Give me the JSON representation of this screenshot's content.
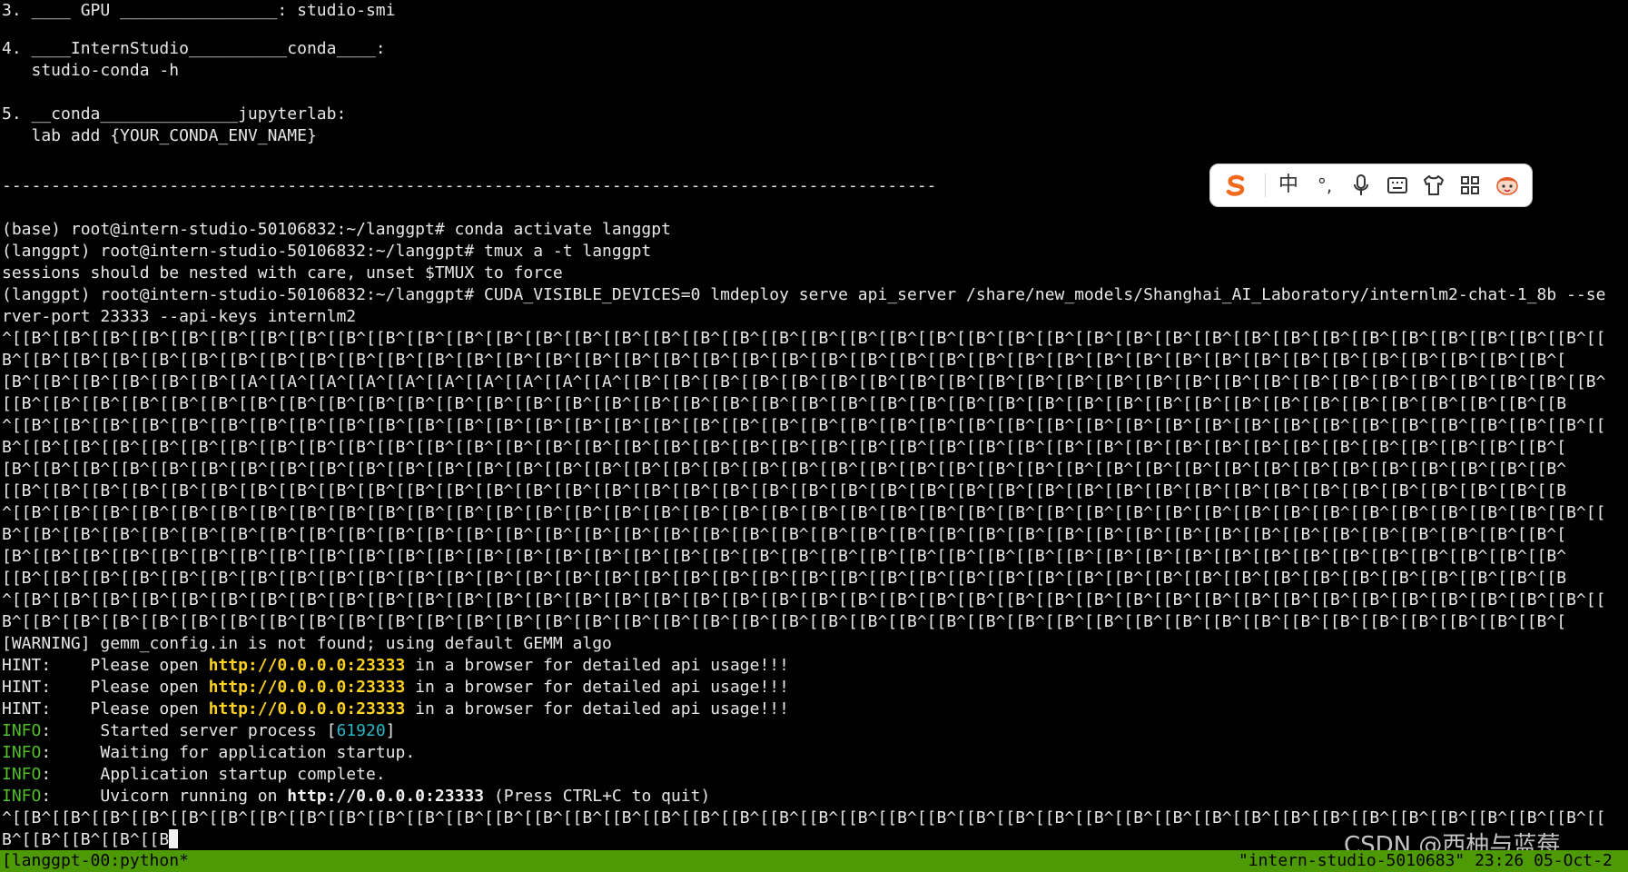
{
  "terminal": {
    "lines": {
      "l1": "3. ____ GPU ________________: studio-smi",
      "l2": "4. ____InternStudio__________conda____:",
      "l3": "   studio-conda -h",
      "l4": "5. __conda______________jupyterlab:",
      "l5": "   lab add {YOUR_CONDA_ENV_NAME}",
      "l6": "-----------------------------------------------------------------------------------------------",
      "l7": "(base) root@intern-studio-50106832:~/langgpt# conda activate langgpt",
      "l8": "(langgpt) root@intern-studio-50106832:~/langgpt# tmux a -t langgpt",
      "l9": "sessions should be nested with care, unset $TMUX to force",
      "l10": "(langgpt) root@intern-studio-50106832:~/langgpt# CUDA_VISIBLE_DEVICES=0 lmdeploy serve api_server /share/new_models/Shanghai_AI_Laboratory/internlm2-chat-1_8b --se",
      "l11": "rver-port 23333 --api-keys internlm2",
      "e1": "^[[B^[[B^[[B^[[B^[[B^[[B^[[B^[[B^[[B^[[B^[[B^[[B^[[B^[[B^[[B^[[B^[[B^[[B^[[B^[[B^[[B^[[B^[[B^[[B^[[B^[[B^[[B^[[B^[[B^[[B^[[B^[[B^[[B^[[B^[[B^[[B^[[B^[[B^[[B^[[B^[[",
      "e2": "B^[[B^[[B^[[B^[[B^[[B^[[B^[[B^[[B^[[B^[[B^[[B^[[B^[[B^[[B^[[B^[[B^[[B^[[B^[[B^[[B^[[B^[[B^[[B^[[B^[[B^[[B^[[B^[[B^[[B^[[B^[[B^[[B^[[B^[[B^[[B^[[B^[[B^[[B^[[B^[",
      "e3": "[B^[[B^[[B^[[B^[[B^[[B^[[A^[[A^[[A^[[A^[[A^[[A^[[A^[[A^[[A^[[A^[[B^[[B^[[B^[[B^[[B^[[B^[[B^[[B^[[B^[[B^[[B^[[B^[[B^[[B^[[B^[[B^[[B^[[B^[[B^[[B^[[B^[[B^[[B^[[B^[[B^",
      "e4": "[[B^[[B^[[B^[[B^[[B^[[B^[[B^[[B^[[B^[[B^[[B^[[B^[[B^[[B^[[B^[[B^[[B^[[B^[[B^[[B^[[B^[[B^[[B^[[B^[[B^[[B^[[B^[[B^[[B^[[B^[[B^[[B^[[B^[[B^[[B^[[B^[[B^[[B^[[B^[[B",
      "e5": "^[[B^[[B^[[B^[[B^[[B^[[B^[[B^[[B^[[B^[[B^[[B^[[B^[[B^[[B^[[B^[[B^[[B^[[B^[[B^[[B^[[B^[[B^[[B^[[B^[[B^[[B^[[B^[[B^[[B^[[B^[[B^[[B^[[B^[[B^[[B^[[B^[[B^[[B^[[B^[[B^[[",
      "e6": "B^[[B^[[B^[[B^[[B^[[B^[[B^[[B^[[B^[[B^[[B^[[B^[[B^[[B^[[B^[[B^[[B^[[B^[[B^[[B^[[B^[[B^[[B^[[B^[[B^[[B^[[B^[[B^[[B^[[B^[[B^[[B^[[B^[[B^[[B^[[B^[[B^[[B^[[B^[[B^[",
      "e7": "[B^[[B^[[B^[[B^[[B^[[B^[[B^[[B^[[B^[[B^[[B^[[B^[[B^[[B^[[B^[[B^[[B^[[B^[[B^[[B^[[B^[[B^[[B^[[B^[[B^[[B^[[B^[[B^[[B^[[B^[[B^[[B^[[B^[[B^[[B^[[B^[[B^[[B^[[B^[[B^",
      "e8": "[[B^[[B^[[B^[[B^[[B^[[B^[[B^[[B^[[B^[[B^[[B^[[B^[[B^[[B^[[B^[[B^[[B^[[B^[[B^[[B^[[B^[[B^[[B^[[B^[[B^[[B^[[B^[[B^[[B^[[B^[[B^[[B^[[B^[[B^[[B^[[B^[[B^[[B^[[B^[[B",
      "e9": "^[[B^[[B^[[B^[[B^[[B^[[B^[[B^[[B^[[B^[[B^[[B^[[B^[[B^[[B^[[B^[[B^[[B^[[B^[[B^[[B^[[B^[[B^[[B^[[B^[[B^[[B^[[B^[[B^[[B^[[B^[[B^[[B^[[B^[[B^[[B^[[B^[[B^[[B^[[B^[[B^[[",
      "e10": "B^[[B^[[B^[[B^[[B^[[B^[[B^[[B^[[B^[[B^[[B^[[B^[[B^[[B^[[B^[[B^[[B^[[B^[[B^[[B^[[B^[[B^[[B^[[B^[[B^[[B^[[B^[[B^[[B^[[B^[[B^[[B^[[B^[[B^[[B^[[B^[[B^[[B^[[B^[[B^[",
      "e11": "[B^[[B^[[B^[[B^[[B^[[B^[[B^[[B^[[B^[[B^[[B^[[B^[[B^[[B^[[B^[[B^[[B^[[B^[[B^[[B^[[B^[[B^[[B^[[B^[[B^[[B^[[B^[[B^[[B^[[B^[[B^[[B^[[B^[[B^[[B^[[B^[[B^[[B^[[B^[[B^",
      "e12": "[[B^[[B^[[B^[[B^[[B^[[B^[[B^[[B^[[B^[[B^[[B^[[B^[[B^[[B^[[B^[[B^[[B^[[B^[[B^[[B^[[B^[[B^[[B^[[B^[[B^[[B^[[B^[[B^[[B^[[B^[[B^[[B^[[B^[[B^[[B^[[B^[[B^[[B^[[B^[[B",
      "e13": "^[[B^[[B^[[B^[[B^[[B^[[B^[[B^[[B^[[B^[[B^[[B^[[B^[[B^[[B^[[B^[[B^[[B^[[B^[[B^[[B^[[B^[[B^[[B^[[B^[[B^[[B^[[B^[[B^[[B^[[B^[[B^[[B^[[B^[[B^[[B^[[B^[[B^[[B^[[B^[[B^[[",
      "e14": "B^[[B^[[B^[[B^[[B^[[B^[[B^[[B^[[B^[[B^[[B^[[B^[[B^[[B^[[B^[[B^[[B^[[B^[[B^[[B^[[B^[[B^[[B^[[B^[[B^[[B^[[B^[[B^[[B^[[B^[[B^[[B^[[B^[[B^[[B^[[B^[[B^[[B^[[B^[[B^[",
      "w1": "[WARNING] gemm_config.in is not found; using default GEMM algo",
      "hint_prefix": "HINT:    Please open ",
      "hint_url": "http://0.0.0.0:23333",
      "hint_suffix": " in a browser for detailed api usage!!!",
      "info_tag": "INFO",
      "info1_pre": ":     Started server process [",
      "info1_pid": "61920",
      "info1_post": "]",
      "info2": ":     Waiting for application startup.",
      "info3": ":     Application startup complete.",
      "info4_pre": ":     Uvicorn running on ",
      "info4_url": "http://0.0.0.0:23333",
      "info4_post": " (Press CTRL+C to quit)",
      "f1": "^[[B^[[B^[[B^[[B^[[B^[[B^[[B^[[B^[[B^[[B^[[B^[[B^[[B^[[B^[[B^[[B^[[B^[[B^[[B^[[B^[[B^[[B^[[B^[[B^[[B^[[B^[[B^[[B^[[B^[[B^[[B^[[B^[[B^[[B^[[B^[[B^[[B^[[B^[[B^[[B^[[",
      "f2": "B^[[B^[[B^[[B^[[B"
    }
  },
  "ime_toolbar": {
    "logo_icon": "sogou-logo-icon",
    "mode_label": "中",
    "punct_label": "°,",
    "icons": [
      "microphone-icon",
      "keyboard-icon",
      "skin-icon",
      "toolbox-icon",
      "mascot-icon"
    ]
  },
  "status_bar": {
    "left": "[langgpt-00:python*",
    "right": "\"intern-studio-5010683\" 23:26 05-Oct-2"
  },
  "watermark": "CSDN @西柚与蓝莓",
  "colors": {
    "background": "#000000",
    "text": "#e8e8e8",
    "url_yellow": "#ffd21e",
    "info_green": "#4fbf2a",
    "pid_cyan": "#2bb6c7",
    "status_bar_green": "#4e9a06"
  }
}
